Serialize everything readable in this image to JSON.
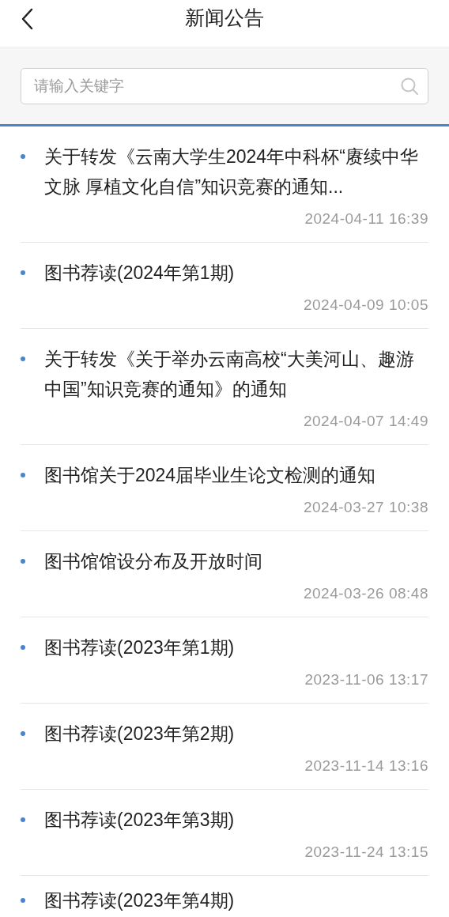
{
  "header": {
    "title": "新闻公告"
  },
  "search": {
    "placeholder": "请输入关键字"
  },
  "news": [
    {
      "title": "关于转发《云南大学生2024年中科杯“赓续中华文脉 厚植文化自信”知识竞赛的通知...",
      "date": "2024-04-11 16:39"
    },
    {
      "title": "图书荐读(2024年第1期)",
      "date": "2024-04-09 10:05"
    },
    {
      "title": "关于转发《关于举办云南高校“大美河山、趣游中国”知识竞赛的通知》的通知",
      "date": "2024-04-07 14:49"
    },
    {
      "title": "图书馆关于2024届毕业生论文检测的通知",
      "date": "2024-03-27 10:38"
    },
    {
      "title": "图书馆馆设分布及开放时间",
      "date": "2024-03-26 08:48"
    },
    {
      "title": "图书荐读(2023年第1期)",
      "date": "2023-11-06 13:17"
    },
    {
      "title": "图书荐读(2023年第2期)",
      "date": "2023-11-14 13:16"
    },
    {
      "title": "图书荐读(2023年第3期)",
      "date": "2023-11-24 13:15"
    },
    {
      "title": "图书荐读(2023年第4期)"
    }
  ]
}
